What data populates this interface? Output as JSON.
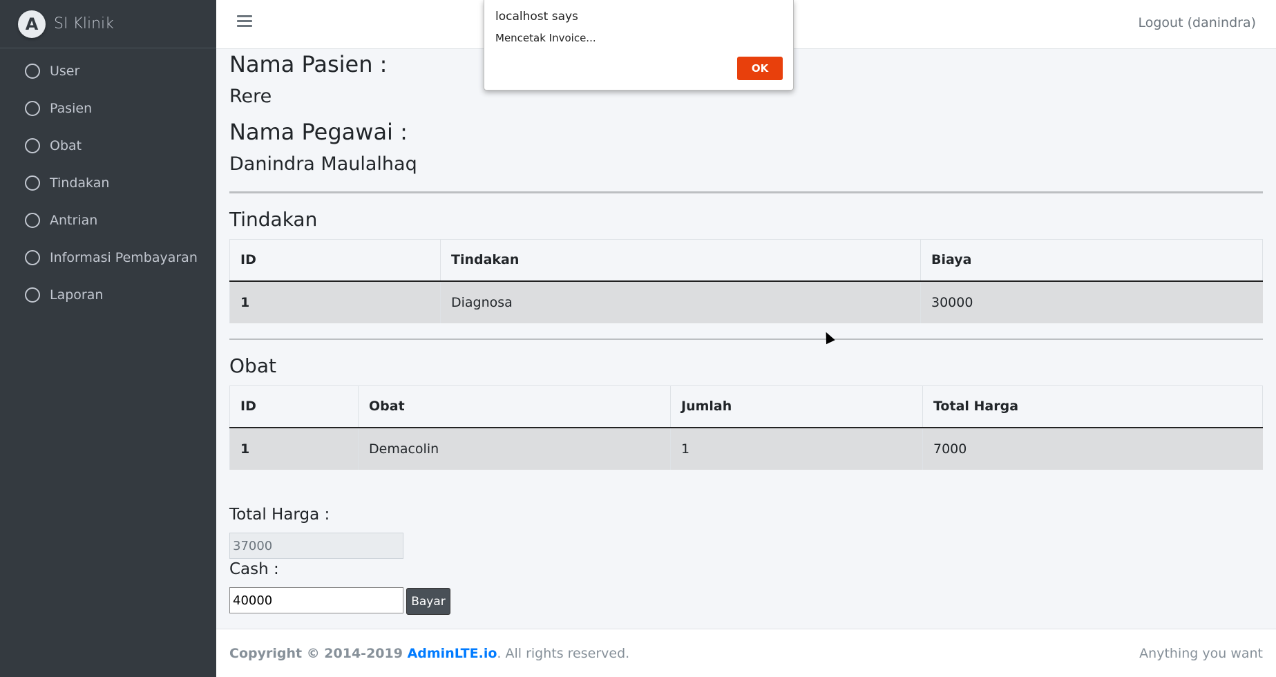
{
  "brand": {
    "name": "SI Klinik",
    "logo_letter": "A"
  },
  "sidebar": {
    "items": [
      {
        "label": "User"
      },
      {
        "label": "Pasien"
      },
      {
        "label": "Obat"
      },
      {
        "label": "Tindakan"
      },
      {
        "label": "Antrian"
      },
      {
        "label": "Informasi Pembayaran"
      },
      {
        "label": "Laporan"
      }
    ]
  },
  "header": {
    "logout_label": "Logout (danindra)"
  },
  "invoice": {
    "patient_label": "Nama Pasien :",
    "patient_name": "Rere",
    "employee_label": "Nama Pegawai :",
    "employee_name": "Danindra Maulalhaq"
  },
  "tindakan": {
    "title": "Tindakan",
    "headers": [
      "ID",
      "Tindakan",
      "Biaya"
    ],
    "rows": [
      [
        "1",
        "Diagnosa",
        "30000"
      ]
    ]
  },
  "obat": {
    "title": "Obat",
    "headers": [
      "ID",
      "Obat",
      "Jumlah",
      "Total Harga"
    ],
    "rows": [
      [
        "1",
        "Demacolin",
        "1",
        "7000"
      ]
    ]
  },
  "payment": {
    "total_label": "Total Harga :",
    "total_value": "37000",
    "cash_label": "Cash :",
    "cash_value": "40000",
    "pay_button": "Bayar"
  },
  "footer": {
    "copyright_prefix": "Copyright © 2014-2019 ",
    "brand_link": "AdminLTE.io",
    "suffix": ". All rights reserved.",
    "right_text": "Anything you want"
  },
  "dialog": {
    "title": "localhost says",
    "message": "Mencetak Invoice...",
    "ok_label": "OK"
  }
}
